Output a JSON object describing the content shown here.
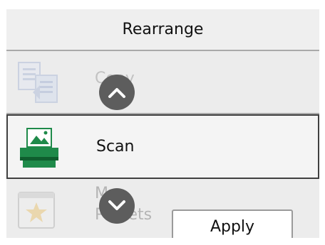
{
  "header": {
    "title": "Rearrange"
  },
  "menu": {
    "items": [
      {
        "label": "Copy",
        "icon": "copy-icon",
        "state": "dimmed"
      },
      {
        "label": "Scan",
        "icon": "scan-icon",
        "state": "selected"
      },
      {
        "label": "My Presets",
        "icon": "presets-star-icon",
        "state": "dimmed"
      }
    ]
  },
  "controls": {
    "scroll_up_icon": "chevron-up-icon",
    "scroll_down_icon": "chevron-down-icon",
    "apply_label": "Apply"
  },
  "colors": {
    "scan_green": "#1f8a4a",
    "selected_border": "#404040",
    "scroll_button": "#5d5d5d",
    "background": "#ececec"
  }
}
